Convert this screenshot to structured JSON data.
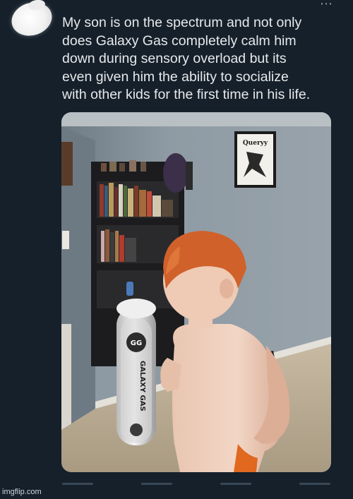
{
  "post": {
    "text": "My son is on the spectrum and not only\ndoes Galaxy Gas completely calm him\ndown during sensory overload but its\neven given him the ability to socialize\nwith other kids for the first time in his life.",
    "more_icon": "ellipsis-icon"
  },
  "photo": {
    "poster_label": "Queryy",
    "product_label": "GALAXY GAS",
    "product_logo": "GG"
  },
  "watermark": "imgflip.com",
  "colors": {
    "background": "#15202b",
    "text": "#e7e9ea",
    "wall": "#8d9aa3",
    "floor": "#b9ab94",
    "hair": "#d0612a"
  }
}
